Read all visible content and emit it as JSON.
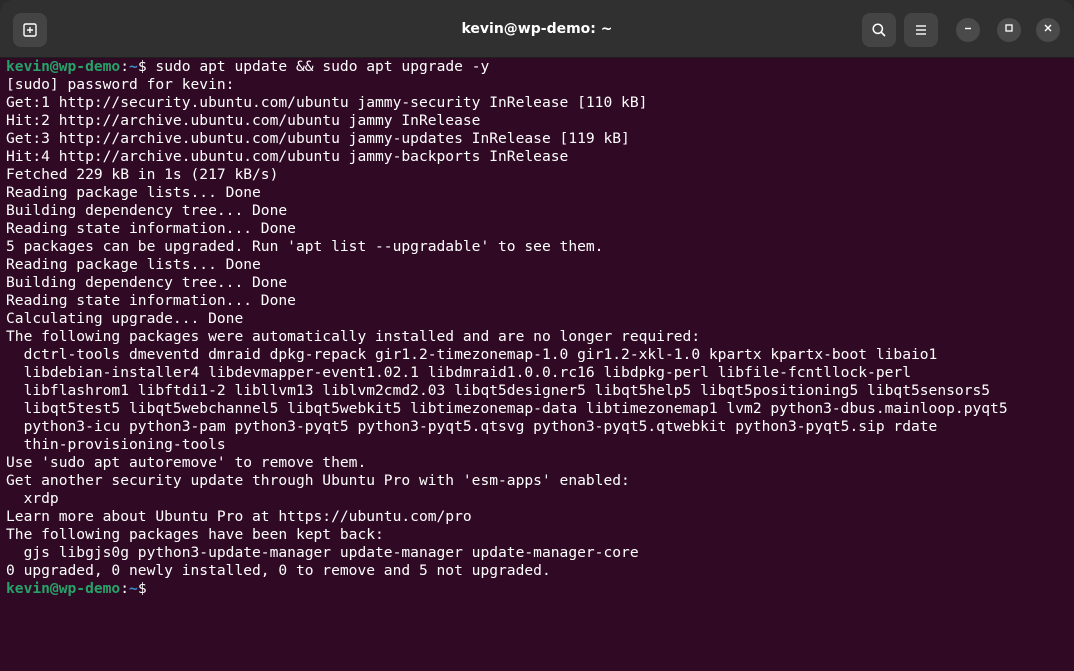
{
  "window": {
    "title": "kevin@wp-demo: ~"
  },
  "titlebar": {
    "new_tab_icon": "new-tab-icon",
    "search_icon": "search-icon",
    "menu_icon": "hamburger-menu-icon",
    "minimize_icon": "minimize-icon",
    "maximize_icon": "maximize-icon",
    "close_icon": "close-icon"
  },
  "colors": {
    "terminal_bg": "#300a24",
    "titlebar_bg": "#303030",
    "prompt_user": "#26a269",
    "prompt_path": "#3d8fd1",
    "text": "#ffffff"
  },
  "terminal": {
    "prompt1": {
      "user_host": "kevin@wp-demo",
      "sep": ":",
      "path": "~",
      "symbol": "$ ",
      "command": "sudo apt update && sudo apt upgrade -y"
    },
    "lines": [
      "[sudo] password for kevin:",
      "Get:1 http://security.ubuntu.com/ubuntu jammy-security InRelease [110 kB]",
      "Hit:2 http://archive.ubuntu.com/ubuntu jammy InRelease",
      "Get:3 http://archive.ubuntu.com/ubuntu jammy-updates InRelease [119 kB]",
      "Hit:4 http://archive.ubuntu.com/ubuntu jammy-backports InRelease",
      "Fetched 229 kB in 1s (217 kB/s)",
      "Reading package lists... Done",
      "Building dependency tree... Done",
      "Reading state information... Done",
      "5 packages can be upgraded. Run 'apt list --upgradable' to see them.",
      "Reading package lists... Done",
      "Building dependency tree... Done",
      "Reading state information... Done",
      "Calculating upgrade... Done",
      "The following packages were automatically installed and are no longer required:",
      "  dctrl-tools dmeventd dmraid dpkg-repack gir1.2-timezonemap-1.0 gir1.2-xkl-1.0 kpartx kpartx-boot libaio1",
      "  libdebian-installer4 libdevmapper-event1.02.1 libdmraid1.0.0.rc16 libdpkg-perl libfile-fcntllock-perl",
      "  libflashrom1 libftdi1-2 libllvm13 liblvm2cmd2.03 libqt5designer5 libqt5help5 libqt5positioning5 libqt5sensors5",
      "  libqt5test5 libqt5webchannel5 libqt5webkit5 libtimezonemap-data libtimezonemap1 lvm2 python3-dbus.mainloop.pyqt5",
      "  python3-icu python3-pam python3-pyqt5 python3-pyqt5.qtsvg python3-pyqt5.qtwebkit python3-pyqt5.sip rdate",
      "  thin-provisioning-tools",
      "Use 'sudo apt autoremove' to remove them.",
      "Get another security update through Ubuntu Pro with 'esm-apps' enabled:",
      "  xrdp",
      "Learn more about Ubuntu Pro at https://ubuntu.com/pro",
      "The following packages have been kept back:",
      "  gjs libgjs0g python3-update-manager update-manager update-manager-core",
      "0 upgraded, 0 newly installed, 0 to remove and 5 not upgraded."
    ],
    "prompt2": {
      "user_host": "kevin@wp-demo",
      "sep": ":",
      "path": "~",
      "symbol": "$"
    }
  }
}
